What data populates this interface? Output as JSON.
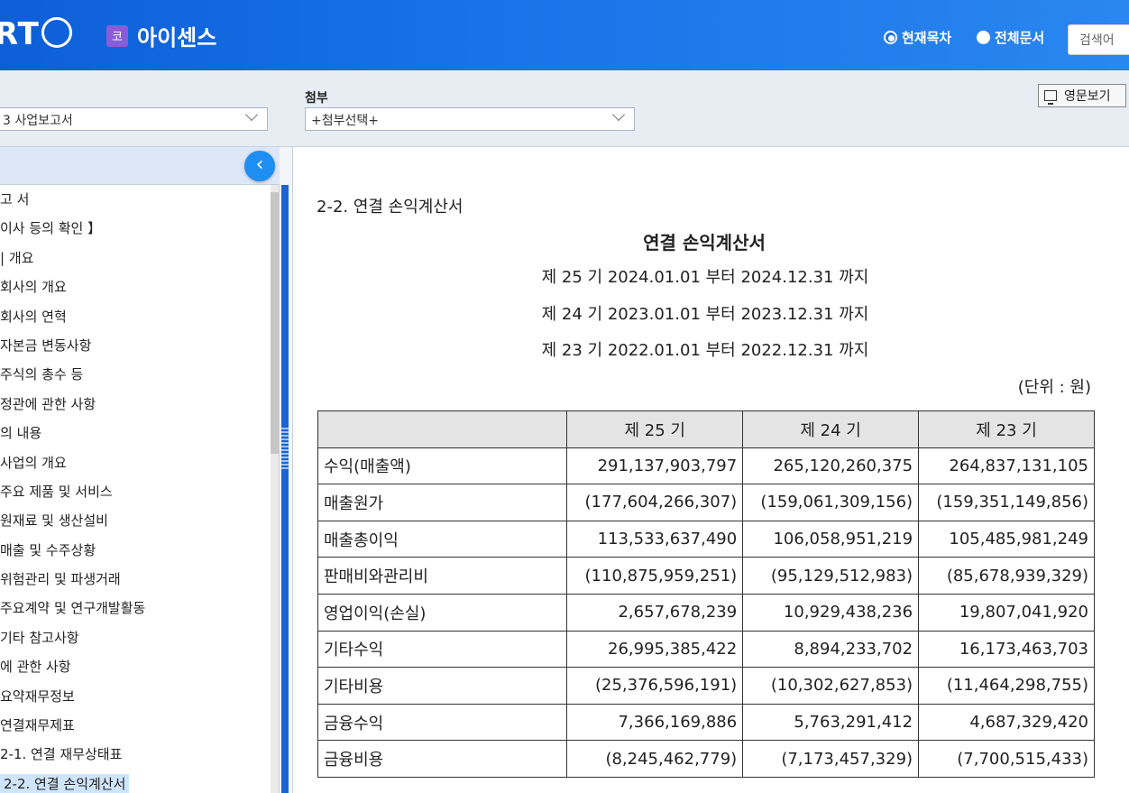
{
  "header": {
    "logo_text": "RT",
    "company_badge": "코",
    "company_name": "아이센스",
    "radio_current": "현재목차",
    "radio_all": "전체문서",
    "search_placeholder": "검색어"
  },
  "toolbar": {
    "report_select": "3  사업보고서",
    "attach_label": "첨부",
    "attach_select": "+첨부선택+",
    "english_button": "영문보기"
  },
  "sidebar": {
    "collapse_icon": "‹",
    "items": [
      "고 서",
      "이사 등의 확인 】",
      "| 개요",
      "회사의 개요",
      "회사의 연혁",
      "자본금 변동사항",
      "주식의 총수 등",
      "정관에 관한 사항",
      "의 내용",
      "사업의 개요",
      "주요 제품 및 서비스",
      "원재료 및 생산설비",
      "매출 및 수주상황",
      "위험관리 및 파생거래",
      "주요계약 및 연구개발활동",
      "기타 참고사항",
      "에 관한 사항",
      "요약재무정보",
      "연결재무제표",
      "  2-1. 연결 재무상태표",
      "  2-2. 연결 손익계산서"
    ],
    "active_index": 20
  },
  "document": {
    "heading": "2-2. 연결 손익계산서",
    "title": "연결 손익계산서",
    "periods": [
      "제 25 기 2024.01.01 부터 2024.12.31 까지",
      "제 24 기 2023.01.01 부터 2023.12.31 까지",
      "제 23 기 2022.01.01 부터 2022.12.31 까지"
    ],
    "unit": "(단위 : 원)",
    "table": {
      "headers": [
        "",
        "제 25 기",
        "제 24 기",
        "제 23 기"
      ],
      "rows": [
        [
          "수익(매출액)",
          "291,137,903,797",
          "265,120,260,375",
          "264,837,131,105"
        ],
        [
          "매출원가",
          "(177,604,266,307)",
          "(159,061,309,156)",
          "(159,351,149,856)"
        ],
        [
          "매출총이익",
          "113,533,637,490",
          "106,058,951,219",
          "105,485,981,249"
        ],
        [
          "판매비와관리비",
          "(110,875,959,251)",
          "(95,129,512,983)",
          "(85,678,939,329)"
        ],
        [
          "영업이익(손실)",
          "2,657,678,239",
          "10,929,438,236",
          "19,807,041,920"
        ],
        [
          "기타수익",
          "26,995,385,422",
          "8,894,233,702",
          "16,173,463,703"
        ],
        [
          "기타비용",
          "(25,376,596,191)",
          "(10,302,627,853)",
          "(11,464,298,755)"
        ],
        [
          "금융수익",
          "7,366,169,886",
          "5,763,291,412",
          "4,687,329,420"
        ],
        [
          "금융비용",
          "(8,245,462,779)",
          "(7,173,457,329)",
          "(7,700,515,433)"
        ]
      ]
    }
  }
}
